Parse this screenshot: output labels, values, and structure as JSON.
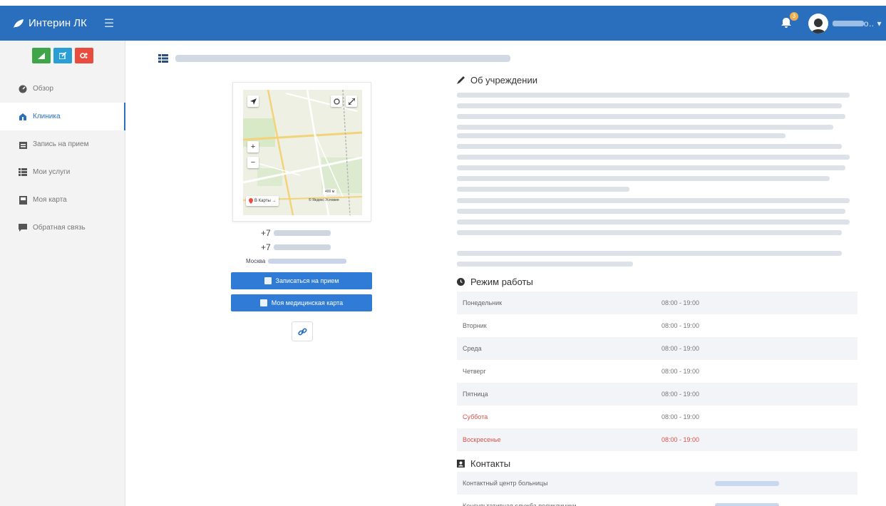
{
  "app": {
    "title": "Интерин ЛК"
  },
  "header": {
    "notifications_count": "3",
    "user_suffix": "о.."
  },
  "sidebar": {
    "items": [
      {
        "label": "Обзор",
        "icon": "dashboard-icon"
      },
      {
        "label": "Клиника",
        "icon": "hospital-icon"
      },
      {
        "label": "Запись на прием",
        "icon": "calendar-icon"
      },
      {
        "label": "Мои услуги",
        "icon": "list-icon"
      },
      {
        "label": "Моя карта",
        "icon": "card-icon"
      },
      {
        "label": "Обратная связь",
        "icon": "comment-icon"
      }
    ]
  },
  "clinic": {
    "phone1_prefix": "+7",
    "phone2_prefix": "+7",
    "address_prefix": "Москва",
    "map": {
      "yandex_label": "В Карты →",
      "attribution": "© Яндекс Условия",
      "scale_label": "400 м",
      "zoom_in": "+",
      "zoom_out": "−"
    },
    "buttons": {
      "appointment": "Записаться на прием",
      "medcard": "Моя медицинская карта"
    }
  },
  "about": {
    "heading": "Об учреждении"
  },
  "schedule": {
    "heading": "Режим работы",
    "rows": [
      {
        "day": "Понедельник",
        "time": "08:00 - 19:00"
      },
      {
        "day": "Вторник",
        "time": "08:00 - 19:00"
      },
      {
        "day": "Среда",
        "time": "08:00 - 19:00"
      },
      {
        "day": "Четверг",
        "time": "08:00 - 19:00"
      },
      {
        "day": "Пятница",
        "time": "08:00 - 19:00"
      },
      {
        "day": "Суббота",
        "time": "08:00 - 19:00"
      },
      {
        "day": "Воскресенье",
        "time": "08:00 - 19:00"
      }
    ]
  },
  "contacts": {
    "heading": "Контакты",
    "rows": [
      {
        "label": "Контактный центр больницы"
      },
      {
        "label": "Консультативная служба поликлиники"
      }
    ]
  },
  "colors": {
    "primary": "#2a6fbe",
    "button": "#2f7bd6",
    "green": "#3ea548",
    "blue": "#2a9fd6",
    "red": "#e74c3c",
    "weekend": "#d9534f"
  }
}
